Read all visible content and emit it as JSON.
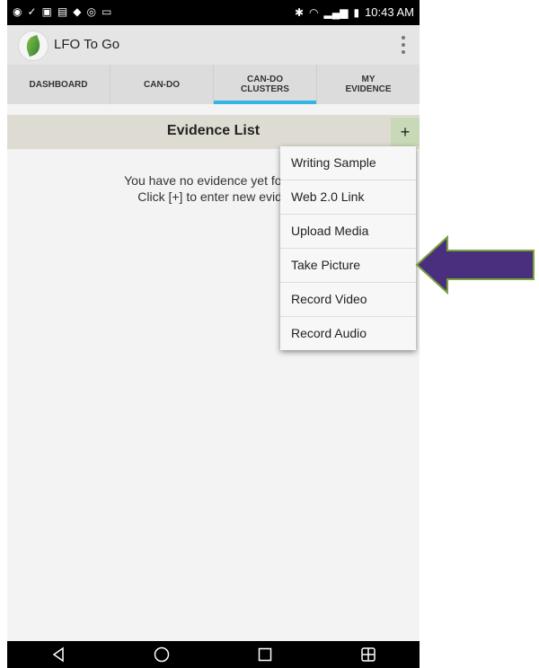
{
  "statusbar": {
    "time": "10:43 AM",
    "icons_left": [
      "location-icon",
      "check-icon",
      "notification-icon",
      "image-icon",
      "android-icon",
      "wifi-icon",
      "notification-icon",
      "message-icon"
    ],
    "icons_right": [
      "bluetooth-icon",
      "wifi-signal-icon",
      "cell-signal-icon",
      "battery-icon"
    ]
  },
  "app": {
    "title": "LFO To Go"
  },
  "tabs": [
    {
      "label": "DASHBOARD"
    },
    {
      "label": "CAN-DO"
    },
    {
      "label": "CAN-DO CLUSTERS"
    },
    {
      "label": "MY EVIDENCE"
    }
  ],
  "active_tab_index": 2,
  "evidence": {
    "title": "Evidence List",
    "add_label": "+",
    "empty_line1": "You have no evidence yet for thi",
    "empty_line2": "Click [+] to enter new evide"
  },
  "menu": {
    "items": [
      "Writing Sample",
      "Web 2.0 Link",
      "Upload Media",
      "Take Picture",
      "Record Video",
      "Record Audio"
    ]
  },
  "colors": {
    "tab_indicator": "#33b5e5",
    "header_bg": "#dedcd2",
    "plus_bg": "#c8d9b7",
    "arrow_fill": "#4a2f7e",
    "arrow_stroke": "#7aa33a"
  },
  "navbar": {
    "icons": [
      "back-icon",
      "home-icon",
      "recents-icon",
      "dual-window-icon"
    ]
  }
}
